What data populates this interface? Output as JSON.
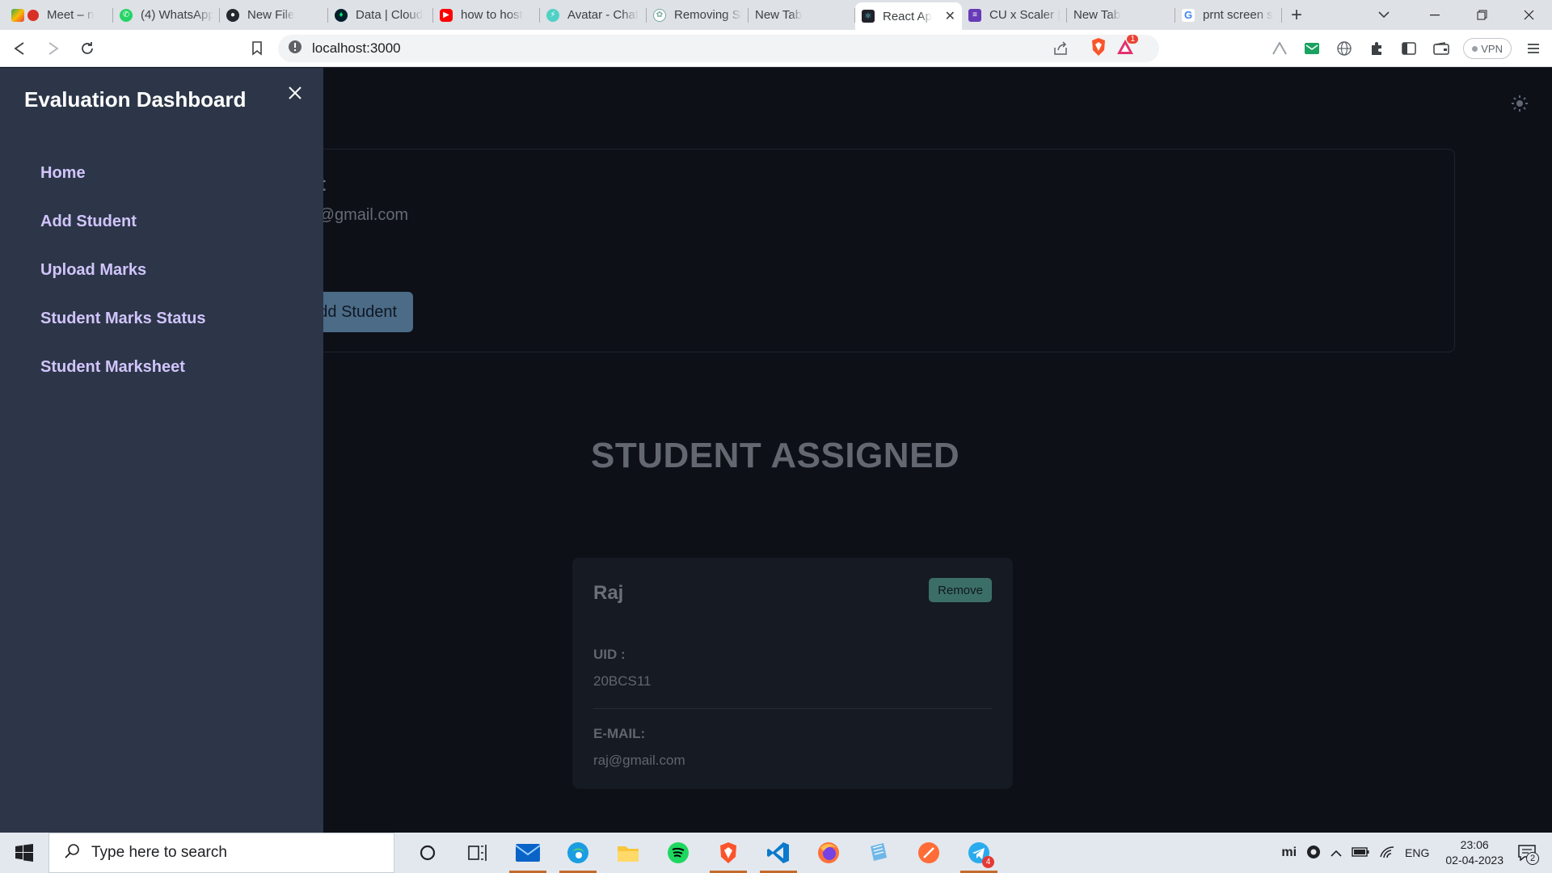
{
  "browser": {
    "tabs": [
      {
        "label": "Meet – n",
        "icon": "google-meet-icon",
        "active": false
      },
      {
        "label": "(4) WhatsApp",
        "icon": "whatsapp-icon",
        "active": false
      },
      {
        "label": "New File",
        "icon": "github-icon",
        "active": false
      },
      {
        "label": "Data | Cloud",
        "icon": "mongodb-icon",
        "active": false
      },
      {
        "label": "how to host",
        "icon": "youtube-icon",
        "active": false
      },
      {
        "label": "Avatar - Chat",
        "icon": "chakra-icon",
        "active": false
      },
      {
        "label": "Removing St",
        "icon": "chatgpt-icon",
        "active": false
      },
      {
        "label": "New Tab",
        "icon": "",
        "active": false
      },
      {
        "label": "React Ap",
        "icon": "react-icon",
        "active": true
      },
      {
        "label": "CU x Scaler |",
        "icon": "form-icon",
        "active": false
      },
      {
        "label": "New Tab",
        "icon": "",
        "active": false
      },
      {
        "label": "prnt screen s",
        "icon": "google-icon",
        "active": false
      }
    ],
    "url": "localhost:3000",
    "vpn_label": "VPN",
    "brave_rewards_badge": "1"
  },
  "sidebar": {
    "title": "Evaluation Dashboard",
    "items": [
      {
        "label": "Home"
      },
      {
        "label": "Add Student"
      },
      {
        "label": "Upload Marks"
      },
      {
        "label": "Student Marks Status"
      },
      {
        "label": "Student Marksheet"
      }
    ]
  },
  "profile": {
    "name_visible": "mit",
    "email_visible": "mit@gmail.com",
    "add_button_label": "Add Student"
  },
  "section": {
    "title": "STUDENT ASSIGNED"
  },
  "student": {
    "name": "Raj",
    "remove_label": "Remove",
    "uid_label": "UID :",
    "uid_value": "20BCS11",
    "email_label": "E-MAIL:",
    "email_value": "raj@gmail.com"
  },
  "taskbar": {
    "search_placeholder": "Type here to search",
    "language": "ENG",
    "time": "23:06",
    "date": "02-04-2023",
    "notification_count": "2",
    "telegram_badge": "4"
  },
  "colors": {
    "app_bg": "#0d1017",
    "sidebar_bg": "#2c3648",
    "sidebar_link": "#d1c4fb",
    "card_bg": "#151a23",
    "remove_button": "#3c6e68",
    "add_button": "#4b6b87"
  }
}
